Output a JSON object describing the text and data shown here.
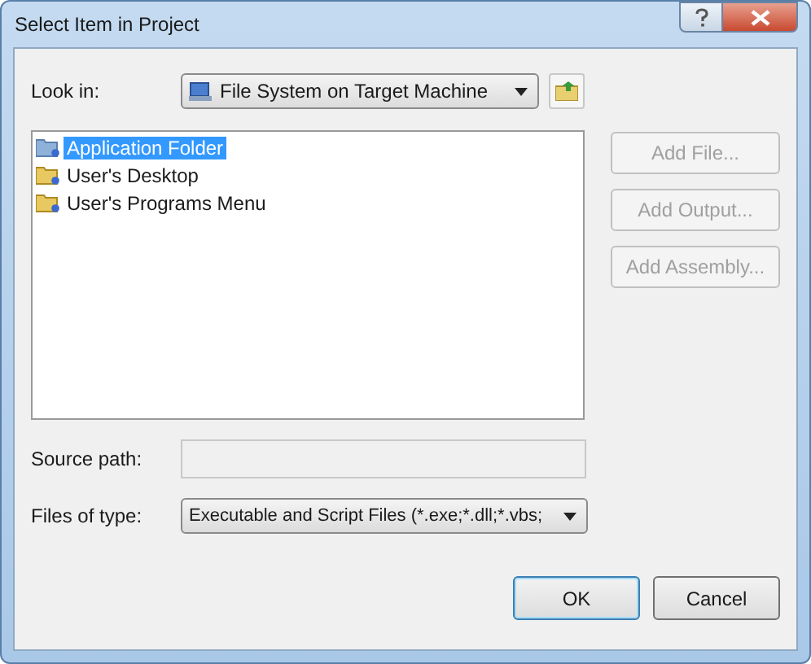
{
  "window": {
    "title": "Select Item in Project"
  },
  "look_in": {
    "label": "Look in:",
    "value": "File System on Target Machine"
  },
  "folders": [
    {
      "label": "Application Folder",
      "selected": true
    },
    {
      "label": "User's Desktop",
      "selected": false
    },
    {
      "label": "User's Programs Menu",
      "selected": false
    }
  ],
  "side_buttons": [
    {
      "label": "Add File...",
      "disabled": true
    },
    {
      "label": "Add Output...",
      "disabled": true
    },
    {
      "label": "Add Assembly...",
      "disabled": true
    }
  ],
  "source_path": {
    "label": "Source path:",
    "disabled": true
  },
  "files_of_type": {
    "label": "Files of type:",
    "value": "Executable and Script Files (*.exe;*.dll;*.vbs;"
  },
  "buttons": [
    {
      "label": "OK",
      "default": true
    },
    {
      "label": "Cancel",
      "default": false
    }
  ]
}
